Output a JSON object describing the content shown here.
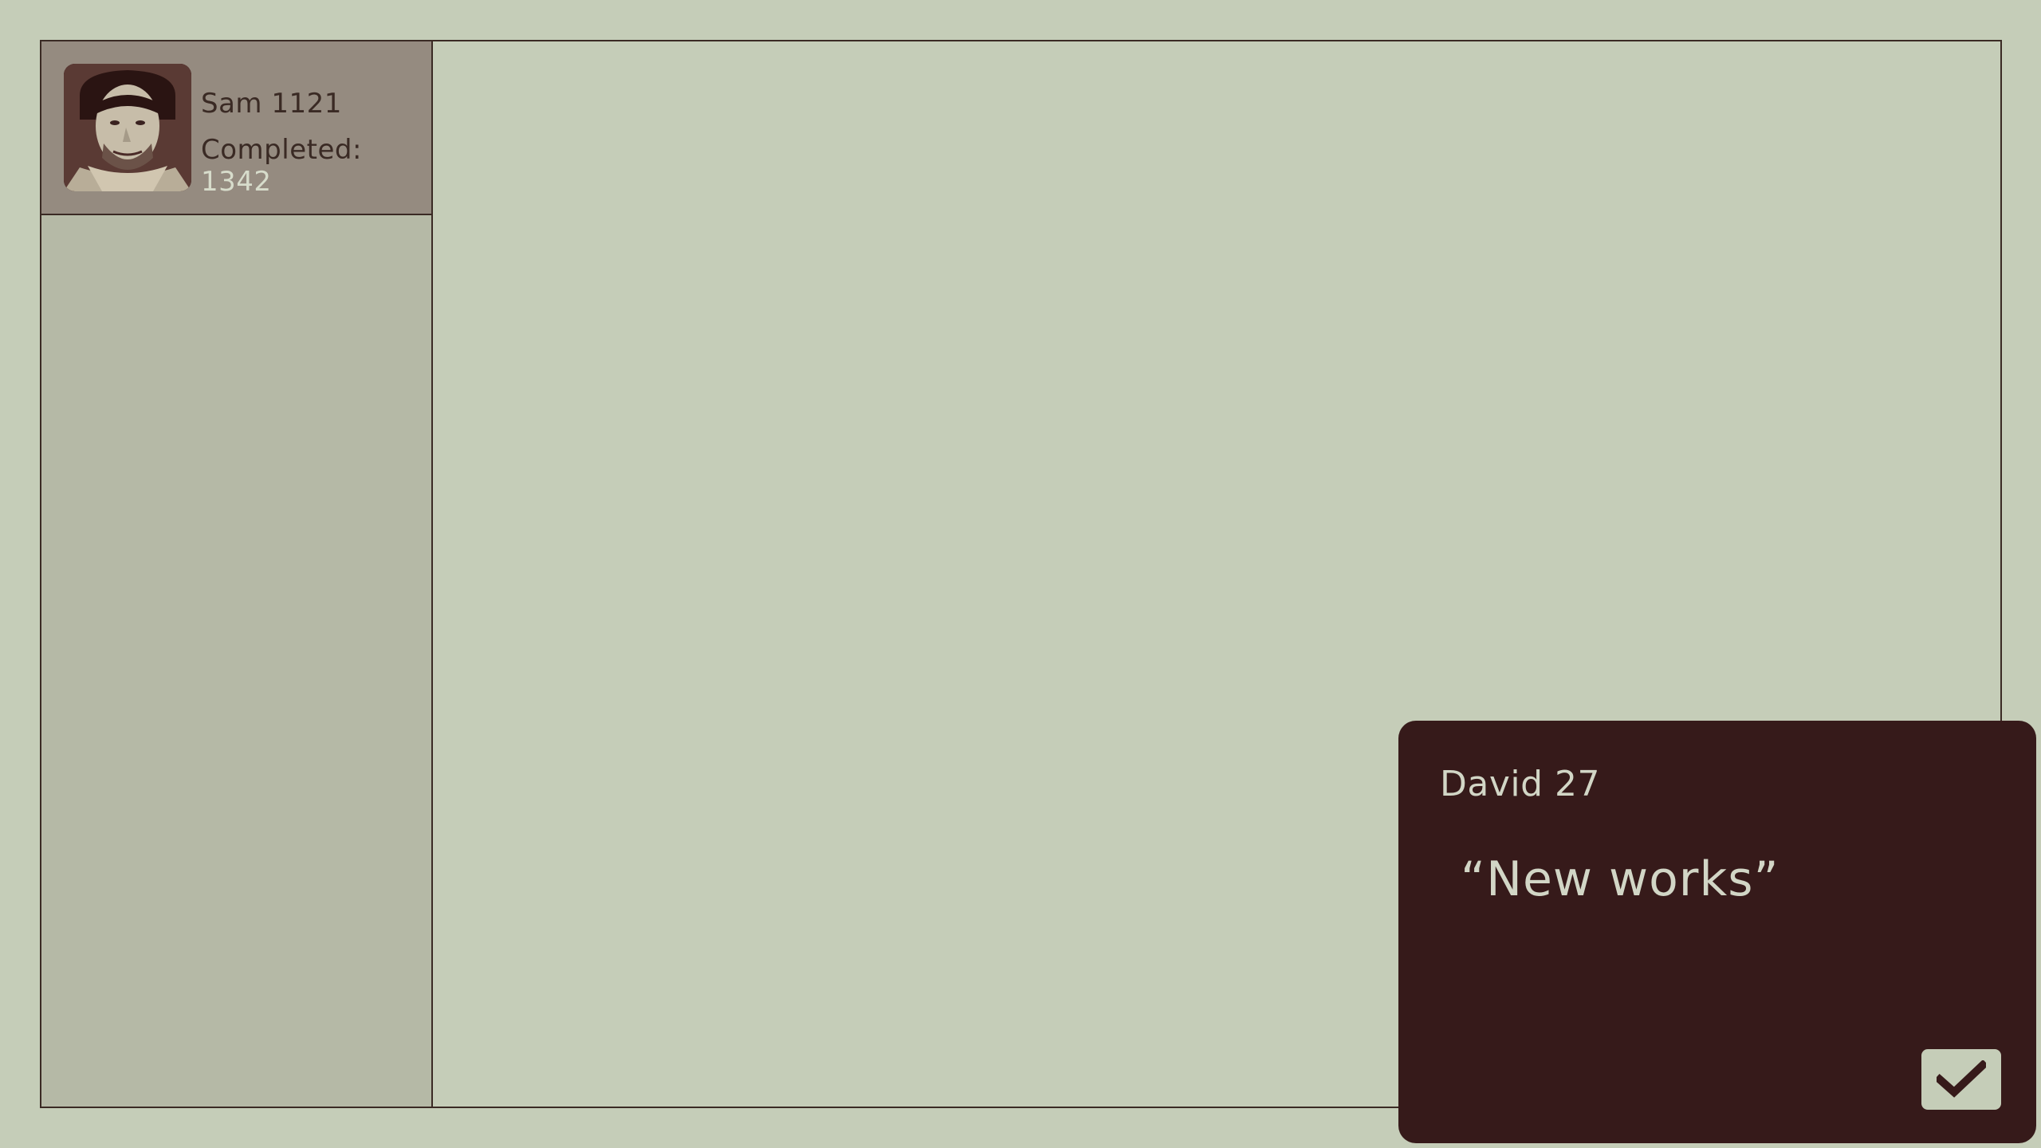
{
  "profile": {
    "name": "Sam 1121",
    "completed_label": "Completed:",
    "completed_count": "1342",
    "avatar_icon": "person-portrait"
  },
  "dialog": {
    "speaker": "David 27",
    "message": "“New works”",
    "confirm_icon": "checkmark-icon"
  },
  "colors": {
    "background": "#c5cdb8",
    "sidebar": "#b5b9a6",
    "profile_card": "#958b80",
    "dialog": "#361a1a",
    "border": "#3a2a24",
    "light_text": "#d2d6c6"
  }
}
